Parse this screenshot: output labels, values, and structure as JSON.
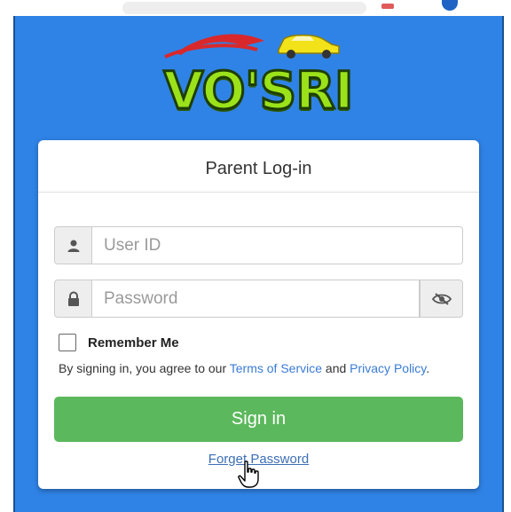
{
  "brand": {
    "logo_text": "VO'SRI"
  },
  "login": {
    "title": "Parent Log-in",
    "user_icon": "user-icon",
    "user_placeholder": "User ID",
    "lock_icon": "lock-icon",
    "password_placeholder": "Password",
    "eye_icon": "eye-slash-icon",
    "remember_label": "Remember Me",
    "terms_prefix": "By signing in, you agree to our ",
    "terms_link": "Terms of Service",
    "terms_and": " and ",
    "privacy_link": "Privacy Policy",
    "terms_suffix": ".",
    "signin_label": "Sign in",
    "forget_label": "Forget Password"
  },
  "colors": {
    "background": "#2f83e6",
    "signin": "#5cb85c",
    "link": "#3a7bd5",
    "logo_green": "#9be21a"
  }
}
